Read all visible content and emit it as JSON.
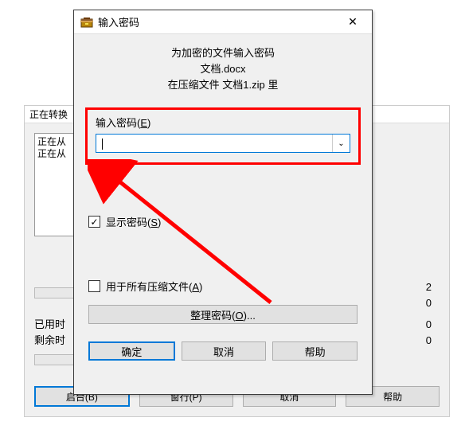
{
  "bg": {
    "title_fragment": "正在转换",
    "list_line1": "正在从",
    "list_line2": "正在从",
    "num1": "2",
    "num2": "0",
    "elapsed_label": "已用时",
    "remaining_label": "剩余时",
    "elapsed_val": "0",
    "remaining_val": "0",
    "btn_start": "启台(B)",
    "btn_pause": "窗行(P)",
    "btn_cancel": "取消",
    "btn_help": "帮助"
  },
  "pw": {
    "title": "输入密码",
    "header_line1": "为加密的文件输入密码",
    "header_line2": "文档.docx",
    "header_line3": "在压缩文件 文档1.zip 里",
    "label_prefix": "输入密码(",
    "label_key": "E",
    "label_suffix": ")",
    "input_value": "",
    "chk_show_prefix": "显示密码(",
    "chk_show_key": "S",
    "chk_show_suffix": ")",
    "chk_all_prefix": "用于所有压缩文件(",
    "chk_all_key": "A",
    "chk_all_suffix": ")",
    "manage_prefix": "整理密码(",
    "manage_key": "O",
    "manage_suffix": ")...",
    "btn_ok": "确定",
    "btn_cancel": "取消",
    "btn_help": "帮助"
  },
  "icons": {
    "dropdown": "⌄",
    "close": "✕"
  }
}
